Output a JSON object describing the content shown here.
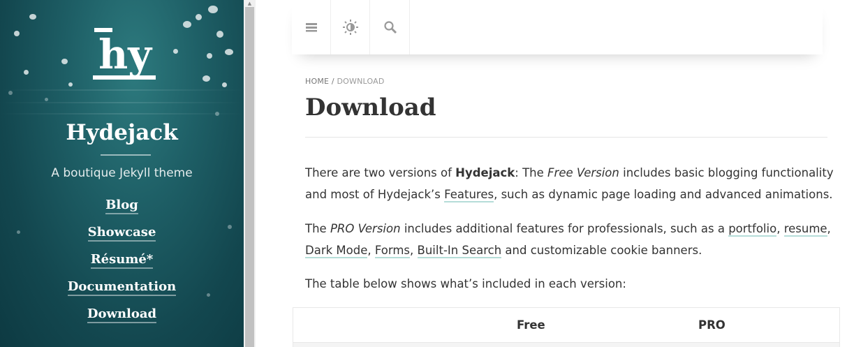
{
  "sidebar": {
    "logo_text": "hy",
    "site_title": "Hydejack",
    "tagline": "A boutique Jekyll theme",
    "nav": [
      "Blog",
      "Showcase",
      "Résumé*",
      "Documentation",
      "Download"
    ]
  },
  "toolbar": {
    "menu_icon": "hamburger-icon",
    "theme_icon": "brightness-icon",
    "search_icon": "search-icon"
  },
  "breadcrumb": {
    "home": "HOME",
    "separator": " / ",
    "current": "DOWNLOAD"
  },
  "page": {
    "title": "Download",
    "p1": {
      "t1": "There are two versions of ",
      "b1": "Hydejack",
      "t2": ": The ",
      "i1": "Free Version",
      "t3": " includes basic blogging functionality and most of Hydejack’s ",
      "link1": "Features",
      "t4": ", such as dynamic page loading and advanced animations."
    },
    "p2": {
      "t1": "The ",
      "i1": "PRO Version",
      "t2": " includes additional features for professionals, such as a ",
      "link1": "portfolio",
      "sep1": ", ",
      "link2": "resume",
      "sep2": ", ",
      "link3": "Dark Mode",
      "sep3": ", ",
      "link4": "Forms",
      "sep4": ", ",
      "link5": "Built-In Search",
      "t3": " and customizable cookie banners."
    },
    "p3": "The table below shows what’s included in each version:"
  },
  "table": {
    "headers": [
      "",
      "Free",
      "PRO"
    ]
  },
  "colors": {
    "accent_link_underline": "#b5ddd8",
    "sidebar_bg": "#1e5f66"
  }
}
